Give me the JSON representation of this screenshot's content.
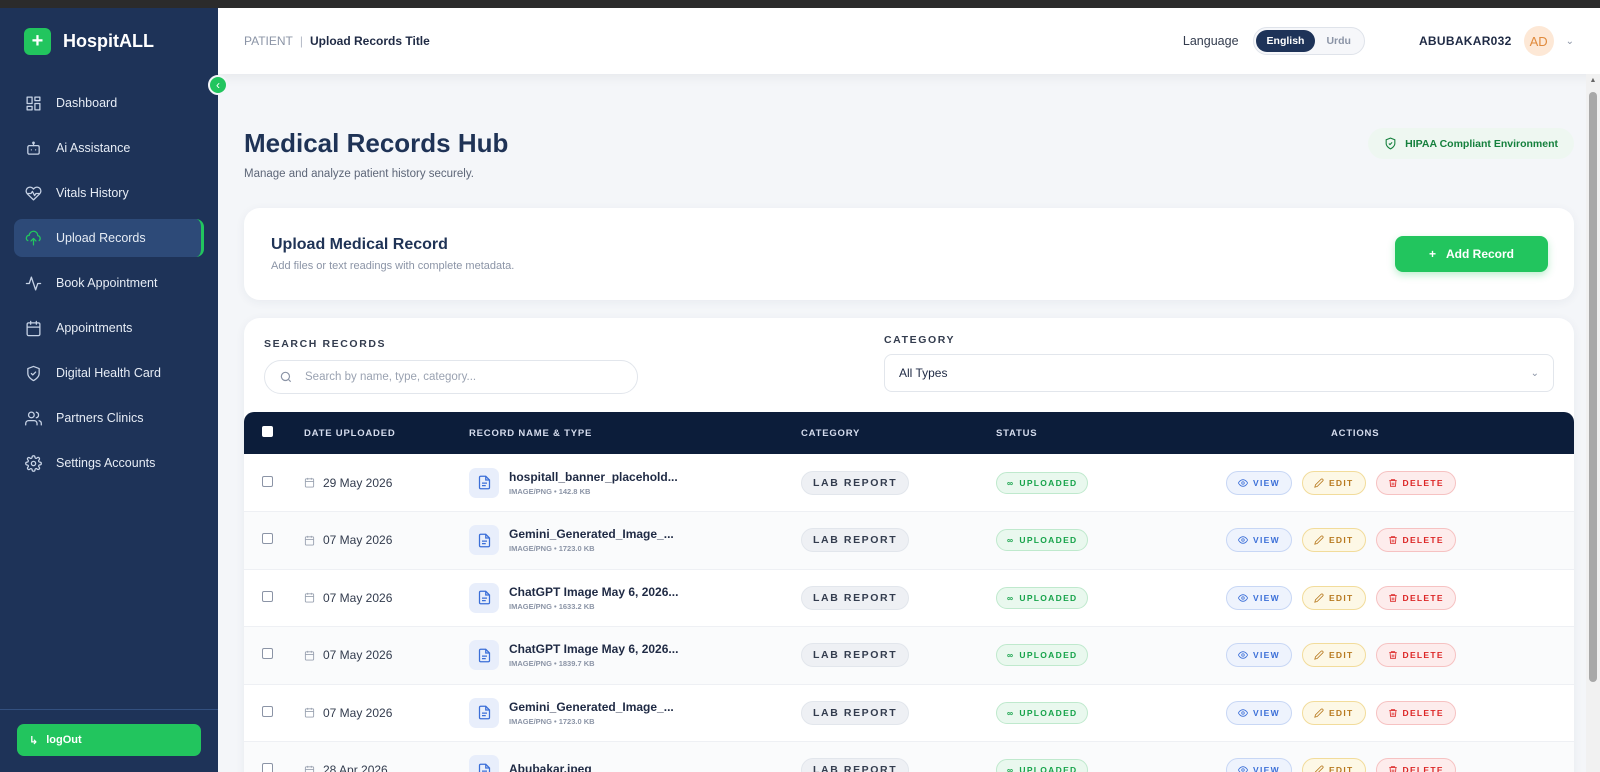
{
  "brand": {
    "name": "HospitALL",
    "logo_glyph": "+"
  },
  "sidebar": {
    "items": [
      {
        "label": "Dashboard",
        "icon": "grid-icon"
      },
      {
        "label": "Ai Assistance",
        "icon": "bot-icon"
      },
      {
        "label": "Vitals History",
        "icon": "heart-pulse-icon"
      },
      {
        "label": "Upload Records",
        "icon": "cloud-upload-icon",
        "active": true
      },
      {
        "label": "Book Appointment",
        "icon": "activity-icon"
      },
      {
        "label": "Appointments",
        "icon": "calendar-icon"
      },
      {
        "label": "Digital Health Card",
        "icon": "shield-check-icon"
      },
      {
        "label": "Partners Clinics",
        "icon": "users-icon"
      },
      {
        "label": "Settings Accounts",
        "icon": "gear-icon"
      }
    ],
    "logout_label": "logOut"
  },
  "topbar": {
    "breadcrumb_root": "PATIENT",
    "breadcrumb_sep": "|",
    "breadcrumb_current": "Upload Records Title",
    "language_label": "Language",
    "languages": [
      "English",
      "Urdu"
    ],
    "active_language": "English",
    "username": "ABUBAKAR032",
    "avatar_initials": "AD"
  },
  "hero": {
    "title": "Medical Records Hub",
    "subtitle": "Manage and analyze patient history securely.",
    "hipaa_badge": "HIPAA Compliant Environment"
  },
  "upload": {
    "title": "Upload Medical Record",
    "subtitle": "Add files or text readings with complete metadata.",
    "add_button": "Add Record"
  },
  "filters": {
    "search_label": "SEARCH RECORDS",
    "search_placeholder": "Search by name, type, category...",
    "category_label": "CATEGORY",
    "category_value": "All Types"
  },
  "table": {
    "columns": [
      "DATE UPLOADED",
      "RECORD NAME & TYPE",
      "CATEGORY",
      "STATUS",
      "ACTIONS"
    ],
    "action_labels": {
      "view": "VIEW",
      "edit": "EDIT",
      "delete": "DELETE"
    },
    "rows": [
      {
        "date": "29 May 2026",
        "name": "hospitall_banner_placehold...",
        "meta": "IMAGE/PNG • 142.8 KB",
        "category": "LAB REPORT",
        "status": "UPLOADED"
      },
      {
        "date": "07 May 2026",
        "name": "Gemini_Generated_Image_...",
        "meta": "IMAGE/PNG • 1723.0 KB",
        "category": "LAB REPORT",
        "status": "UPLOADED"
      },
      {
        "date": "07 May 2026",
        "name": "ChatGPT Image May 6, 2026...",
        "meta": "IMAGE/PNG • 1633.2 KB",
        "category": "LAB REPORT",
        "status": "UPLOADED"
      },
      {
        "date": "07 May 2026",
        "name": "ChatGPT Image May 6, 2026...",
        "meta": "IMAGE/PNG • 1839.7 KB",
        "category": "LAB REPORT",
        "status": "UPLOADED"
      },
      {
        "date": "07 May 2026",
        "name": "Gemini_Generated_Image_...",
        "meta": "IMAGE/PNG • 1723.0 KB",
        "category": "LAB REPORT",
        "status": "UPLOADED"
      },
      {
        "date": "28 Apr 2026",
        "name": "Abubakar.jpeg",
        "meta": "",
        "category": "LAB REPORT",
        "status": "UPLOADED"
      }
    ]
  },
  "colors": {
    "sidebar": "#1e3358",
    "accent": "#22c55e",
    "table_header": "#0c1d3a"
  }
}
